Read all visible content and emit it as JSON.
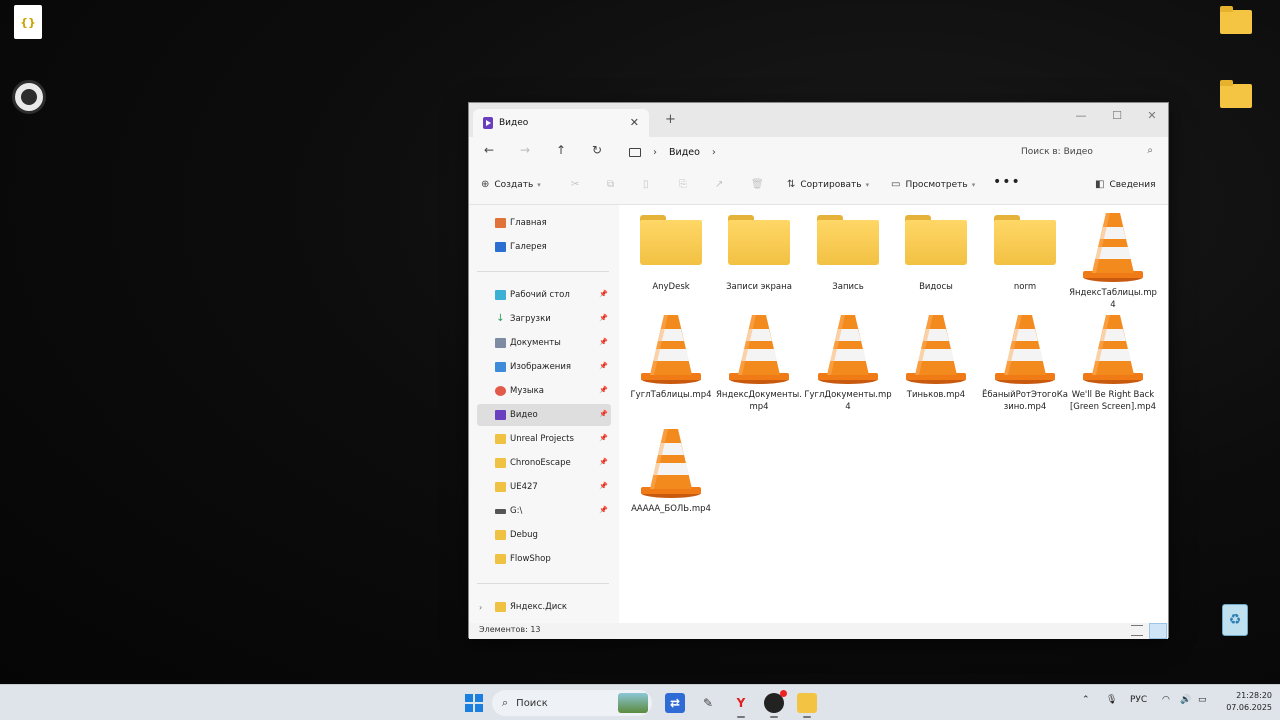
{
  "desktop": {
    "file_glyph": "{}",
    "recycle_glyph": "♻"
  },
  "window": {
    "tab_title": "Видео",
    "tab_close": "✕",
    "tab_add": "+",
    "controls": {
      "minimize": "—",
      "maximize": "☐",
      "close": "✕"
    },
    "address": {
      "back": "←",
      "forward": "→",
      "up": "↑",
      "refresh": "↻",
      "crumbs": [
        "Видео"
      ],
      "search_placeholder": "Поиск в: Видео"
    },
    "toolbar": {
      "create": "Создать",
      "sort": "Сортировать",
      "view": "Просмотреть",
      "more": "•••",
      "details": "Сведения"
    },
    "sidebar": {
      "top": [
        {
          "label": "Главная",
          "icon": "home-icon"
        },
        {
          "label": "Галерея",
          "icon": "gallery-icon"
        }
      ],
      "pinned": [
        {
          "label": "Рабочий стол",
          "icon": "desktop-icon",
          "pinned": true
        },
        {
          "label": "Загрузки",
          "icon": "download-icon",
          "pinned": true
        },
        {
          "label": "Документы",
          "icon": "documents-icon",
          "pinned": true
        },
        {
          "label": "Изображения",
          "icon": "images-icon",
          "pinned": true
        },
        {
          "label": "Музыка",
          "icon": "music-icon",
          "pinned": true
        },
        {
          "label": "Видео",
          "icon": "video-icon",
          "pinned": true,
          "active": true
        },
        {
          "label": "Unreal Projects",
          "icon": "folder-icon",
          "pinned": true
        },
        {
          "label": "ChronoEscape",
          "icon": "folder-icon",
          "pinned": true
        },
        {
          "label": "UE427",
          "icon": "folder-icon",
          "pinned": true
        },
        {
          "label": "G:\\",
          "icon": "drive-icon",
          "pinned": true
        },
        {
          "label": "Debug",
          "icon": "folder-icon",
          "pinned": false
        },
        {
          "label": "FlowShop",
          "icon": "folder-icon",
          "pinned": false
        }
      ],
      "bottom": [
        {
          "label": "Яндекс.Диск",
          "icon": "folder-icon"
        }
      ]
    },
    "files": [
      {
        "name": "AnyDesk",
        "type": "folder"
      },
      {
        "name": "Записи экрана",
        "type": "folder"
      },
      {
        "name": "Запись",
        "type": "folder"
      },
      {
        "name": "Видосы",
        "type": "folder"
      },
      {
        "name": "norm",
        "type": "folder"
      },
      {
        "name": "ЯндексТаблицы.mp4",
        "type": "video"
      },
      {
        "name": "ГуглТаблицы.mp4",
        "type": "video"
      },
      {
        "name": "ЯндексДокументы.mp4",
        "type": "video"
      },
      {
        "name": "ГуглДокументы.mp4",
        "type": "video"
      },
      {
        "name": "Тиньков.mp4",
        "type": "video"
      },
      {
        "name": "ЁбаныйРотЭтогоКазино.mp4",
        "type": "video"
      },
      {
        "name": "We'll Be Right Back [Green Screen].mp4",
        "type": "video"
      },
      {
        "name": "ААААА_БОЛЬ.mp4",
        "type": "video"
      }
    ],
    "status": "Элементов: 13"
  },
  "taskbar": {
    "search_placeholder": "Поиск",
    "language": "РУС",
    "time": "21:28:20",
    "date": "07.06.2025",
    "apps": [
      "remote-desktop-icon",
      "pen-tablet-icon",
      "yandex-browser-icon",
      "obs-icon",
      "file-explorer-icon"
    ]
  }
}
